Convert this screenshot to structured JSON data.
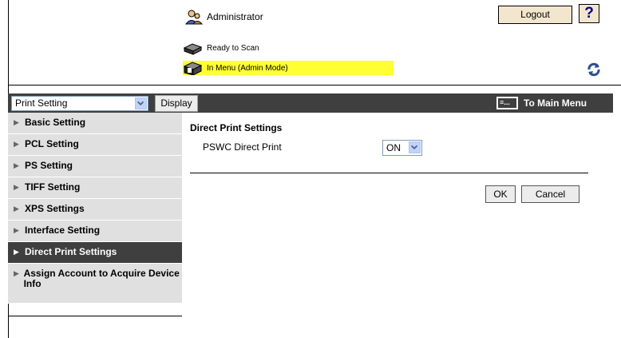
{
  "header": {
    "user_label": "Administrator",
    "logout_label": "Logout",
    "help_label": "?",
    "status": [
      {
        "text": "Ready to Scan",
        "highlight": false
      },
      {
        "text": "In Menu (Admin Mode)",
        "highlight": true,
        "color": "#ffff33"
      }
    ]
  },
  "toolbar": {
    "category_select": "Print Setting",
    "display_label": "Display",
    "to_main_label": "To Main Menu",
    "color": "#3f3f3f"
  },
  "sidebar": {
    "items": [
      {
        "label": "Basic Setting",
        "active": false
      },
      {
        "label": "PCL Setting",
        "active": false
      },
      {
        "label": "PS Setting",
        "active": false
      },
      {
        "label": "TIFF Setting",
        "active": false
      },
      {
        "label": "XPS Settings",
        "active": false
      },
      {
        "label": "Interface Setting",
        "active": false
      },
      {
        "label": "Direct Print Settings",
        "active": true
      },
      {
        "label": "Assign Account to Acquire Device Info",
        "active": false
      }
    ]
  },
  "main": {
    "title": "Direct Print Settings",
    "fields": [
      {
        "label": "PSWC Direct Print",
        "value": "ON"
      }
    ],
    "ok_label": "OK",
    "cancel_label": "Cancel"
  }
}
